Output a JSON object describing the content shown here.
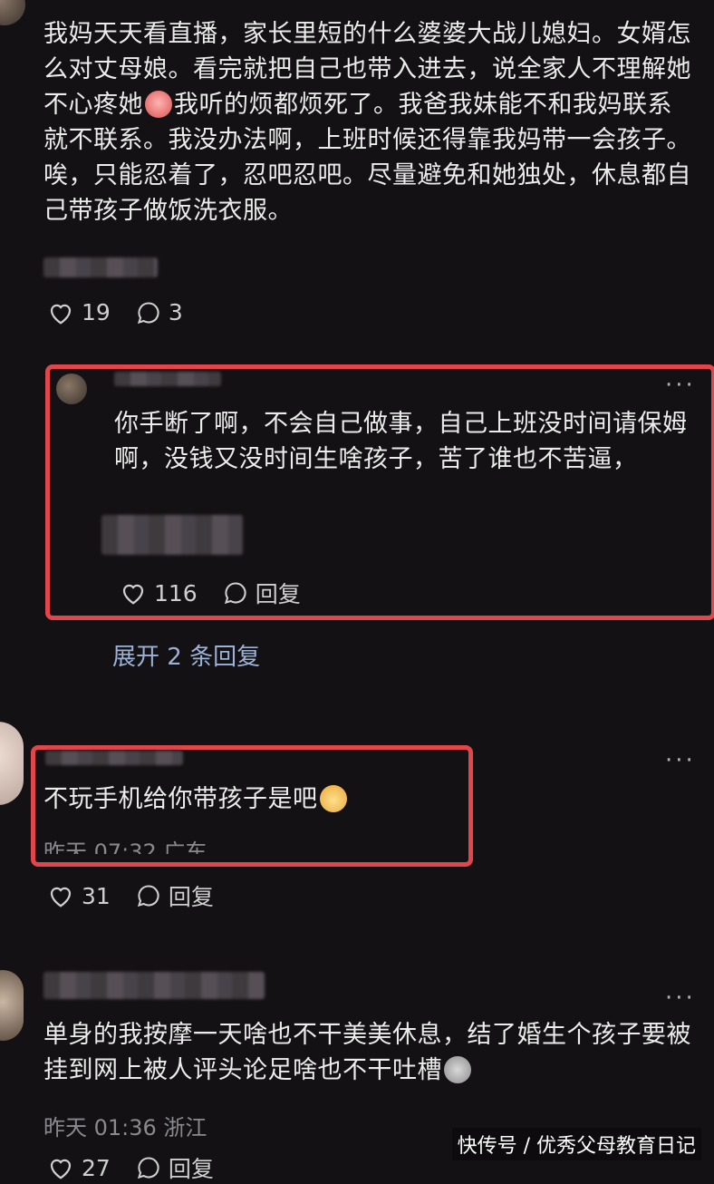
{
  "comments": [
    {
      "text": "我妈天天看直播，家长里短的什么婆婆大战儿媳妇。女婿怎么对丈母娘。看完就把自己也带入进去，说全家人不理解她不心疼她",
      "text_after_emoji": "我听的烦都烦死了。我爸我妹能不和我妈联系就不联系。我没办法啊，上班时候还得靠我妈带一会孩子。唉，只能忍着了，忍吧忍吧。尽量避免和她独处，休息都自己带孩子做饭洗衣服。",
      "likes": "19",
      "replies": "3"
    },
    {
      "text": "你手断了啊，不会自己做事，自己上班没时间请保姆啊，没钱又没时间生啥孩子，苦了谁也不苦逼，",
      "likes": "116",
      "reply_label": "回复"
    },
    {
      "expand_label": "展开 2 条回复"
    },
    {
      "text": "不玩手机给你带孩子是吧",
      "time": "昨天 07:32 广东",
      "likes": "31",
      "reply_label": "回复"
    },
    {
      "text": "单身的我按摩一天啥也不干美美休息，结了婚生个孩子要被挂到网上被人评头论足啥也不干吐槽",
      "time": "昨天 01:36 浙江",
      "likes": "27",
      "reply_label": "回复"
    }
  ],
  "more_label": "···",
  "watermark": "快传号 / 优秀父母教育日记",
  "colors": {
    "highlight": "#e0464a",
    "link": "#9bb2d6",
    "background": "#141114"
  },
  "icons": [
    "heart-icon",
    "comment-bubble-icon",
    "crying-emoji-icon",
    "baby-emoji-icon",
    "sweat-emoji-icon"
  ]
}
